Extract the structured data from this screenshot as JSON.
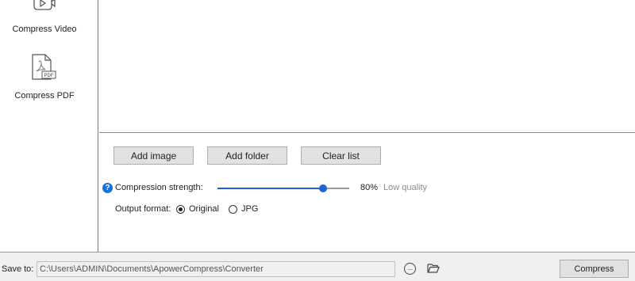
{
  "sidebar": {
    "items": [
      {
        "label": "Compress Video",
        "icon": "video-file-icon"
      },
      {
        "label": "Compress PDF",
        "icon": "pdf-file-icon",
        "badge": "PDF"
      }
    ]
  },
  "actions": {
    "add_image": "Add image",
    "add_folder": "Add folder",
    "clear_list": "Clear list"
  },
  "compression": {
    "help_glyph": "?",
    "label": "Compression strength:",
    "value_percent": 80,
    "value_text": "80%",
    "quality_text": "Low quality"
  },
  "output_format": {
    "label": "Output format:",
    "options": [
      {
        "label": "Original",
        "selected": true
      },
      {
        "label": "JPG",
        "selected": false
      }
    ]
  },
  "save": {
    "label": "Save to:",
    "path": "C:\\Users\\ADMIN\\Documents\\ApowerCompress\\Converter",
    "more_glyph": "···",
    "compress_button": "Compress"
  },
  "colors": {
    "accent": "#1f63d8",
    "help_icon": "#1a6fd6",
    "muted_text": "#8a8a8a",
    "button_bg": "#e1e1e1"
  }
}
